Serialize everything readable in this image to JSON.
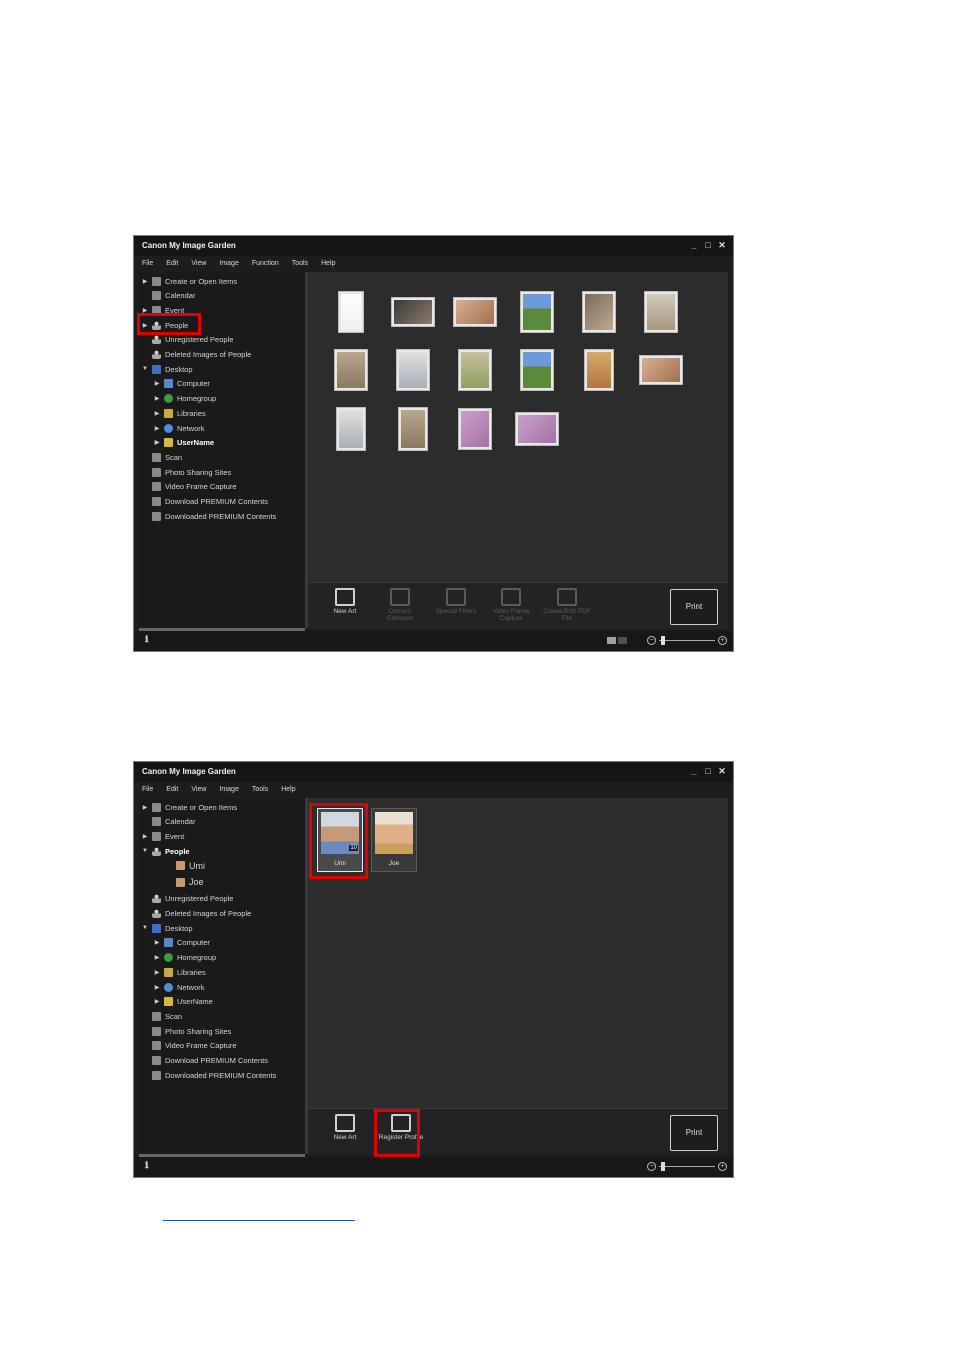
{
  "app": {
    "title": "Canon My Image Garden"
  },
  "window1": {
    "menu": [
      "File",
      "Edit",
      "View",
      "Image",
      "Function",
      "Tools",
      "Help"
    ],
    "tree": [
      {
        "label": "Create or Open Items",
        "icon": "create-icon",
        "arrow": true,
        "indent": 0
      },
      {
        "label": "Calendar",
        "icon": "calendar-icon",
        "arrow": false,
        "indent": 0
      },
      {
        "label": "Event",
        "icon": "event-icon",
        "arrow": true,
        "indent": 0
      },
      {
        "label": "People",
        "icon": "person-icon",
        "arrow": true,
        "indent": 0
      },
      {
        "label": "Unregistered People",
        "icon": "unregistered-person-icon",
        "arrow": false,
        "indent": 0
      },
      {
        "label": "Deleted Images of People",
        "icon": "deleted-person-icon",
        "arrow": false,
        "indent": 0
      },
      {
        "label": "Desktop",
        "icon": "desktop-icon",
        "arrow": true,
        "open": true,
        "indent": 0
      },
      {
        "label": "Computer",
        "icon": "computer-icon",
        "arrow": true,
        "indent": 1
      },
      {
        "label": "Homegroup",
        "icon": "homegroup-icon",
        "arrow": true,
        "indent": 1
      },
      {
        "label": "Libraries",
        "icon": "libraries-icon",
        "arrow": true,
        "indent": 1
      },
      {
        "label": "Network",
        "icon": "network-icon",
        "arrow": true,
        "indent": 1
      },
      {
        "label": "UserName",
        "icon": "user-folder-icon",
        "arrow": true,
        "indent": 1,
        "bold": true
      },
      {
        "label": "Scan",
        "icon": "scan-icon",
        "arrow": false,
        "indent": 0
      },
      {
        "label": "Photo Sharing Sites",
        "icon": "photo-sharing-icon",
        "arrow": false,
        "indent": 0
      },
      {
        "label": "Video Frame Capture",
        "icon": "video-frame-icon",
        "arrow": false,
        "indent": 0
      },
      {
        "label": "Download PREMIUM Contents",
        "icon": "download-icon",
        "arrow": false,
        "indent": 0
      },
      {
        "label": "Downloaded PREMIUM Contents",
        "icon": "downloaded-folder-icon",
        "arrow": false,
        "indent": 0
      }
    ],
    "tools": [
      {
        "label": "New Art",
        "icon": "new-art-icon",
        "enabled": true
      },
      {
        "label": "Correct/ Enhance",
        "icon": "correct-enhance-icon",
        "enabled": false
      },
      {
        "label": "Special Filters",
        "icon": "special-filters-icon",
        "enabled": false
      },
      {
        "label": "Video Frame Capture",
        "icon": "video-frame-capture-icon",
        "enabled": false
      },
      {
        "label": "Create/Edit PDF File",
        "icon": "pdf-icon",
        "enabled": false
      }
    ],
    "print": "Print"
  },
  "window2": {
    "menu": [
      "File",
      "Edit",
      "View",
      "Image",
      "Tools",
      "Help"
    ],
    "tree": [
      {
        "label": "Create or Open Items",
        "icon": "create-icon",
        "arrow": true,
        "indent": 0
      },
      {
        "label": "Calendar",
        "icon": "calendar-icon",
        "arrow": false,
        "indent": 0
      },
      {
        "label": "Event",
        "icon": "event-icon",
        "arrow": true,
        "indent": 0
      },
      {
        "label": "People",
        "icon": "person-icon",
        "arrow": true,
        "open": true,
        "indent": 0,
        "bold": true
      },
      {
        "label": "Umi",
        "icon": "face-icon",
        "arrow": false,
        "indent": 2,
        "large": true
      },
      {
        "label": "Joe",
        "icon": "face-icon",
        "arrow": false,
        "indent": 2,
        "large": true
      },
      {
        "label": "Unregistered People",
        "icon": "unregistered-person-icon",
        "arrow": false,
        "indent": 0
      },
      {
        "label": "Deleted Images of People",
        "icon": "deleted-person-icon",
        "arrow": false,
        "indent": 0
      },
      {
        "label": "Desktop",
        "icon": "desktop-icon",
        "arrow": true,
        "open": true,
        "indent": 0
      },
      {
        "label": "Computer",
        "icon": "computer-icon",
        "arrow": true,
        "indent": 1
      },
      {
        "label": "Homegroup",
        "icon": "homegroup-icon",
        "arrow": true,
        "indent": 1
      },
      {
        "label": "Libraries",
        "icon": "libraries-icon",
        "arrow": true,
        "indent": 1
      },
      {
        "label": "Network",
        "icon": "network-icon",
        "arrow": true,
        "indent": 1
      },
      {
        "label": "UserName",
        "icon": "user-folder-icon",
        "arrow": true,
        "indent": 1
      },
      {
        "label": "Scan",
        "icon": "scan-icon",
        "arrow": false,
        "indent": 0
      },
      {
        "label": "Photo Sharing Sites",
        "icon": "photo-sharing-icon",
        "arrow": false,
        "indent": 0
      },
      {
        "label": "Video Frame Capture",
        "icon": "video-frame-icon",
        "arrow": false,
        "indent": 0
      },
      {
        "label": "Download PREMIUM Contents",
        "icon": "download-icon",
        "arrow": false,
        "indent": 0
      },
      {
        "label": "Downloaded PREMIUM Contents",
        "icon": "downloaded-folder-icon",
        "arrow": false,
        "indent": 0
      }
    ],
    "people": [
      {
        "name": "Umi",
        "count": "10",
        "selected": true
      },
      {
        "name": "Joe",
        "count": "",
        "selected": false
      }
    ],
    "tools": [
      {
        "label": "New Art",
        "icon": "new-art-icon",
        "enabled": true
      },
      {
        "label": "Register Profile",
        "icon": "register-profile-icon",
        "enabled": true
      }
    ],
    "print": "Print"
  },
  "colors": {
    "highlight": "#e00000",
    "window_bg": "#1d1d1d",
    "link": "#2255cc"
  }
}
